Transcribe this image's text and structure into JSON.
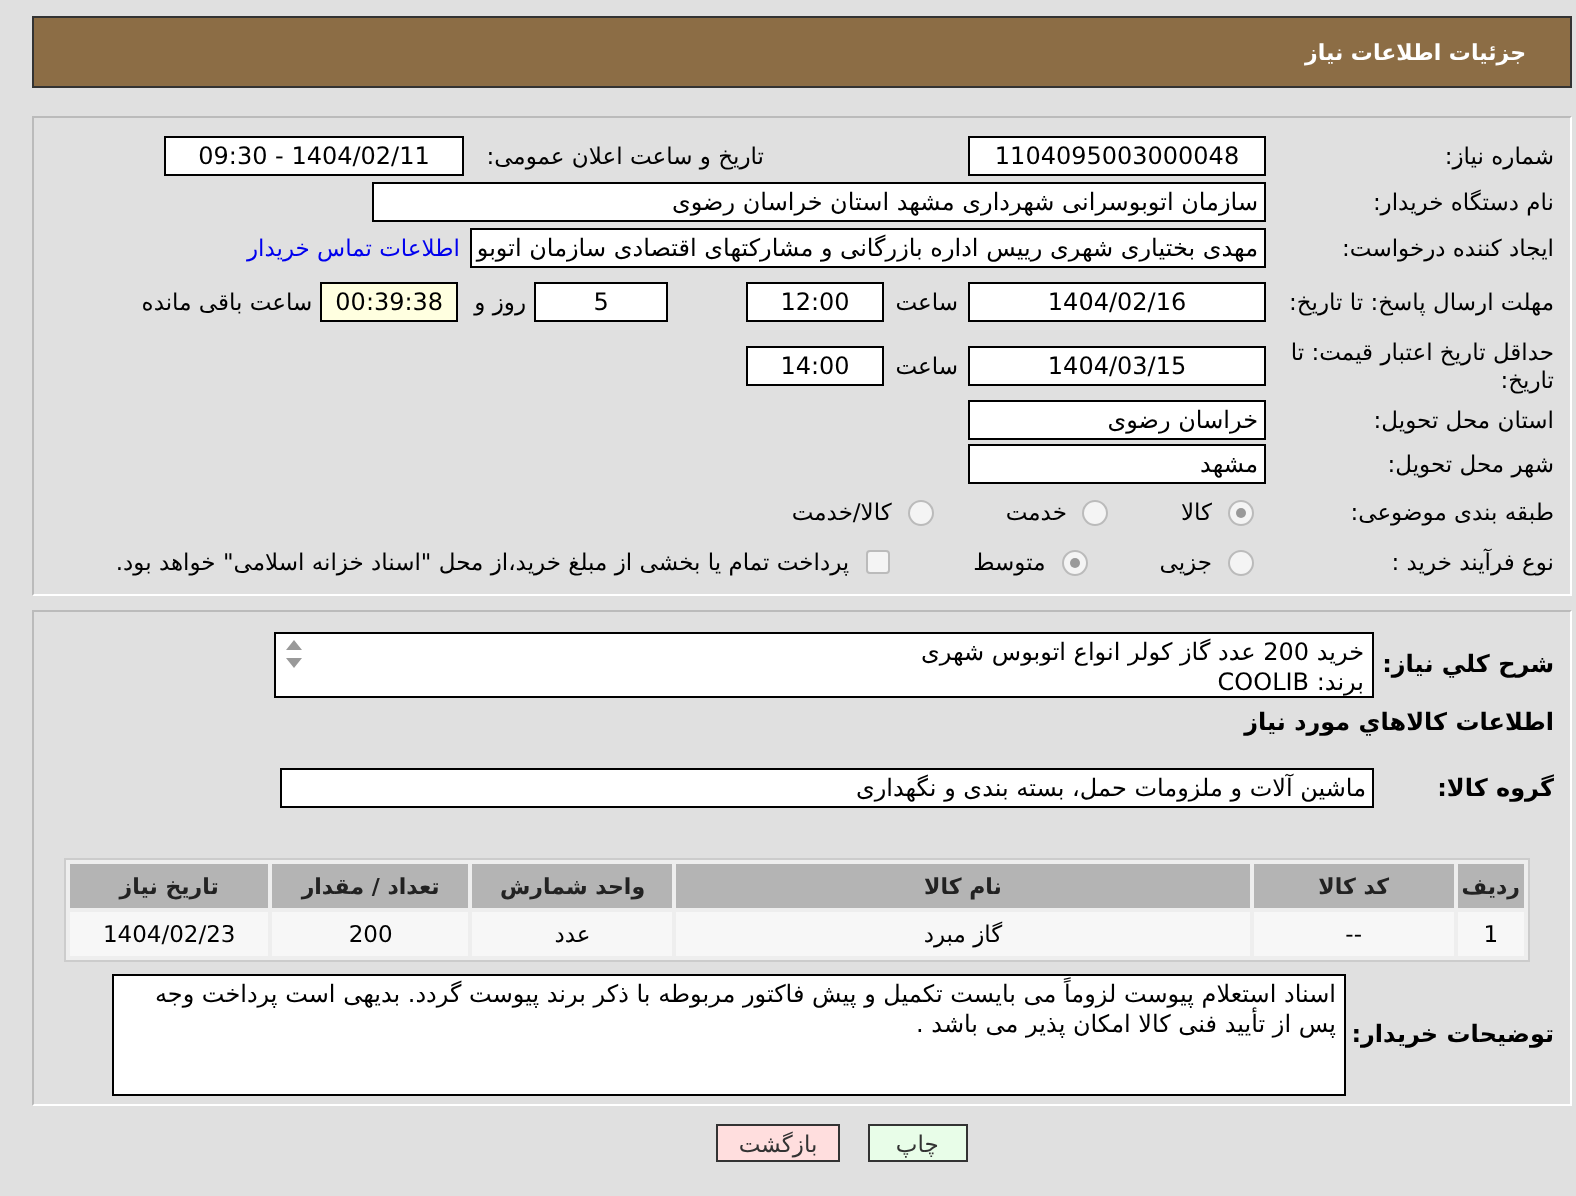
{
  "header": {
    "title": "جزئیات اطلاعات نیاز"
  },
  "need_number": {
    "label": "شماره نیاز:",
    "value": "1104095003000048"
  },
  "announce": {
    "label": "تاریخ و ساعت اعلان عمومی:",
    "value": "1404/02/11 - 09:30"
  },
  "buyer_org": {
    "label": "نام دستگاه خریدار:",
    "value": "سازمان اتوبوسرانی شهرداری مشهد استان خراسان رضوی"
  },
  "requester": {
    "label": "ایجاد کننده درخواست:",
    "value": "مهدی بختیاری شهری رییس اداره بازرگانی و مشارکتهای اقتصادی سازمان اتوبو",
    "link": "اطلاعات تماس خریدار"
  },
  "deadline": {
    "label": "مهلت ارسال پاسخ: تا تاریخ:",
    "date": "1404/02/16",
    "time_label": "ساعت",
    "time": "12:00",
    "days": "5",
    "days_label": "روز و",
    "remaining": "00:39:38",
    "remaining_label": "ساعت باقی مانده"
  },
  "validity": {
    "label": "حداقل تاریخ اعتبار قیمت: تا تاریخ:",
    "date": "1404/03/15",
    "time_label": "ساعت",
    "time": "14:00"
  },
  "province": {
    "label": "استان محل تحویل:",
    "value": "خراسان رضوی"
  },
  "city": {
    "label": "شهر محل تحویل:",
    "value": "مشهد"
  },
  "category": {
    "label": "طبقه بندی موضوعی:",
    "options": [
      {
        "label": "کالا",
        "selected": true
      },
      {
        "label": "خدمت",
        "selected": false
      },
      {
        "label": "کالا/خدمت",
        "selected": false
      }
    ]
  },
  "process": {
    "label": "نوع فرآیند خرید :",
    "options": [
      {
        "label": "جزیی",
        "selected": false
      },
      {
        "label": "متوسط",
        "selected": true
      }
    ],
    "payment": {
      "label": "پرداخت تمام یا بخشی از مبلغ خرید،از محل \"اسناد خزانه اسلامی\" خواهد بود.",
      "checked": false
    }
  },
  "description": {
    "label": "شرح كلي نياز:",
    "lines": [
      "خرید 200 عدد گاز کولر انواع اتوبوس شهری",
      "برند: COOLIB"
    ]
  },
  "goods_title": "اطلاعات كالاهاي مورد نياز",
  "goods_group": {
    "label": "گروه کالا:",
    "value": "ماشین آلات و ملزومات حمل، بسته بندی و نگهداری"
  },
  "table": {
    "columns": [
      "ردیف",
      "کد کالا",
      "نام کالا",
      "واحد شمارش",
      "تعداد / مقدار",
      "تاریخ نیاز"
    ],
    "rows": [
      [
        "1",
        "--",
        "گاز مبرد",
        "عدد",
        "200",
        "1404/02/23"
      ]
    ]
  },
  "buyer_notes": {
    "label": "توضیحات خریدار:",
    "value": "اسناد استعلام پیوست لزوماً می بایست تکمیل و پیش فاکتور مربوطه با ذکر برند پیوست گردد. بدیهی است پرداخت وجه پس از تأیید فنی کالا امکان پذیر می باشد ."
  },
  "buttons": [
    {
      "label": "چاپ",
      "kind": "print"
    },
    {
      "label": "بازگشت",
      "kind": "back"
    }
  ]
}
